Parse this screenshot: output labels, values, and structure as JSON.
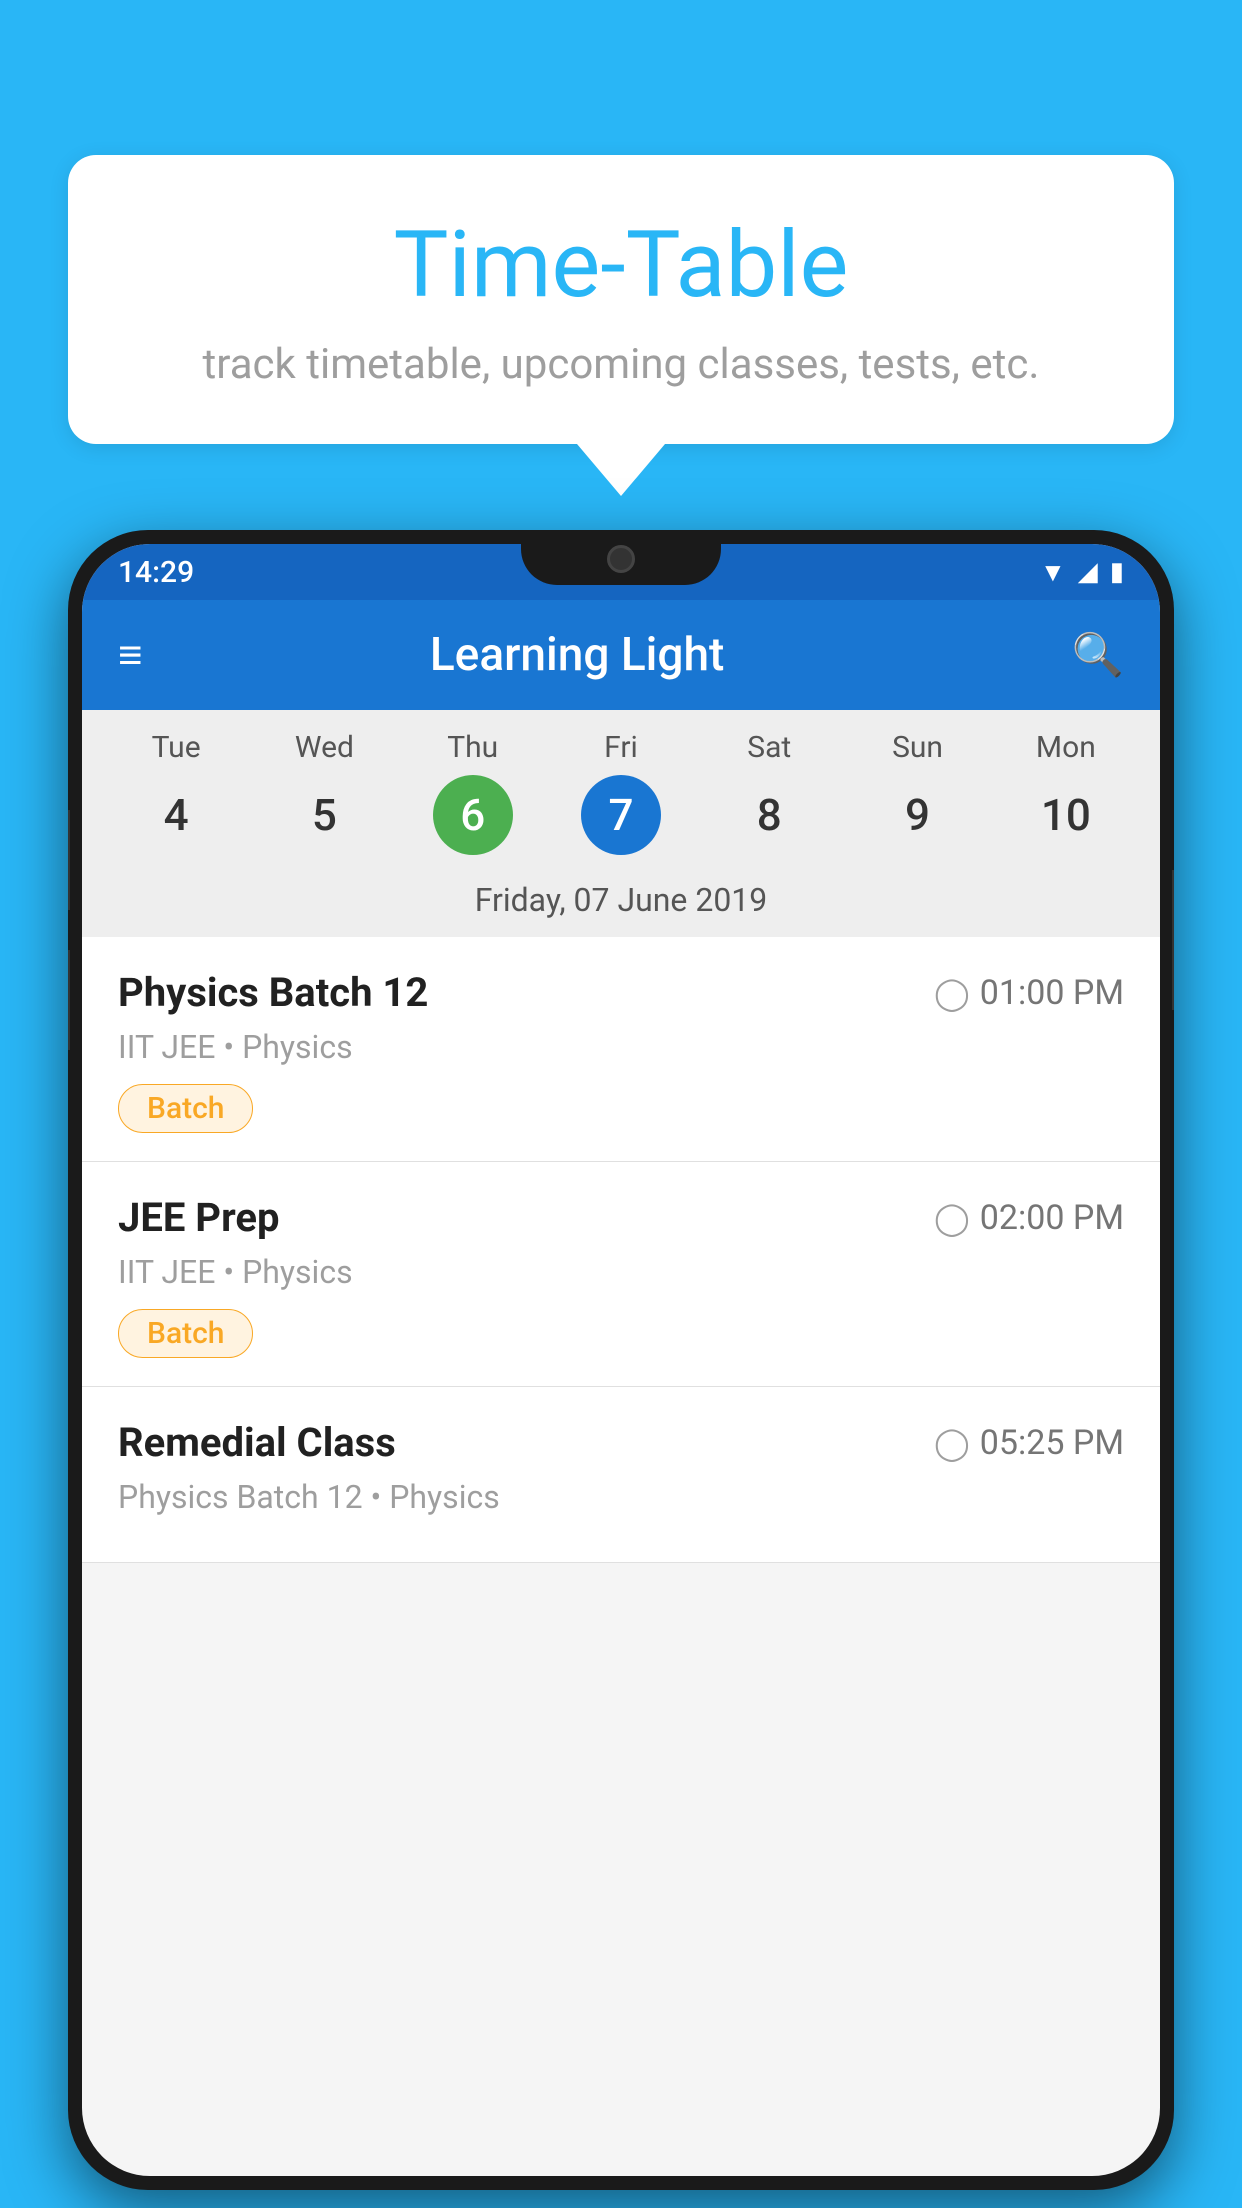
{
  "background_color": "#29B6F6",
  "speech_bubble": {
    "title": "Time-Table",
    "subtitle": "track timetable, upcoming classes, tests, etc."
  },
  "phone": {
    "status_bar": {
      "time": "14:29",
      "wifi": "▼",
      "signal": "▲",
      "battery": "▮"
    },
    "app_bar": {
      "title": "Learning Light",
      "hamburger_icon": "≡",
      "search_icon": "🔍"
    },
    "calendar": {
      "days": [
        {
          "name": "Tue",
          "number": "4",
          "state": "normal"
        },
        {
          "name": "Wed",
          "number": "5",
          "state": "normal"
        },
        {
          "name": "Thu",
          "number": "6",
          "state": "today"
        },
        {
          "name": "Fri",
          "number": "7",
          "state": "selected"
        },
        {
          "name": "Sat",
          "number": "8",
          "state": "normal"
        },
        {
          "name": "Sun",
          "number": "9",
          "state": "normal"
        },
        {
          "name": "Mon",
          "number": "10",
          "state": "normal"
        }
      ],
      "selected_date_label": "Friday, 07 June 2019"
    },
    "classes": [
      {
        "name": "Physics Batch 12",
        "time": "01:00 PM",
        "details": "IIT JEE • Physics",
        "badge": "Batch"
      },
      {
        "name": "JEE Prep",
        "time": "02:00 PM",
        "details": "IIT JEE • Physics",
        "badge": "Batch"
      },
      {
        "name": "Remedial Class",
        "time": "05:25 PM",
        "details": "Physics Batch 12 • Physics",
        "badge": ""
      }
    ]
  }
}
